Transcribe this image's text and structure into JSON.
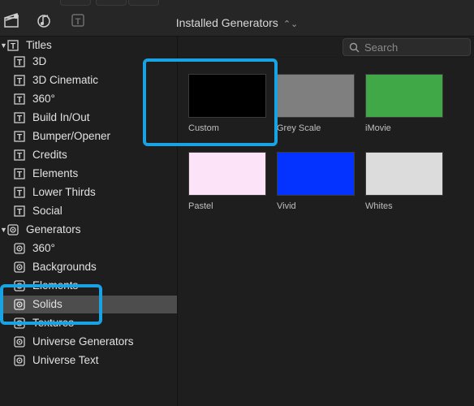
{
  "header": {
    "title": "Installed Generators",
    "chevron": "⌃⌄"
  },
  "search": {
    "placeholder": "Search"
  },
  "sidebar": {
    "groups": [
      {
        "label": "Titles",
        "expanded": true,
        "icon": "titles-icon",
        "items": [
          "3D",
          "3D Cinematic",
          "360°",
          "Build In/Out",
          "Bumper/Opener",
          "Credits",
          "Elements",
          "Lower Thirds",
          "Social"
        ]
      },
      {
        "label": "Generators",
        "expanded": true,
        "icon": "generators-icon",
        "items": [
          "360°",
          "Backgrounds",
          "Elements",
          "Solids",
          "Textures",
          "Universe Generators",
          "Universe Text"
        ],
        "selected": "Solids"
      }
    ]
  },
  "generators": [
    {
      "label": "Custom",
      "color": "#000000"
    },
    {
      "label": "Grey Scale",
      "color": "#7f7f7f"
    },
    {
      "label": "iMovie",
      "color": "#41a847"
    },
    {
      "label": "Pastel",
      "color": "#fde3f8"
    },
    {
      "label": "Vivid",
      "color": "#0433ff"
    },
    {
      "label": "Whites",
      "color": "#dcdcdc"
    }
  ],
  "highlight_color": "#1aa3e4"
}
